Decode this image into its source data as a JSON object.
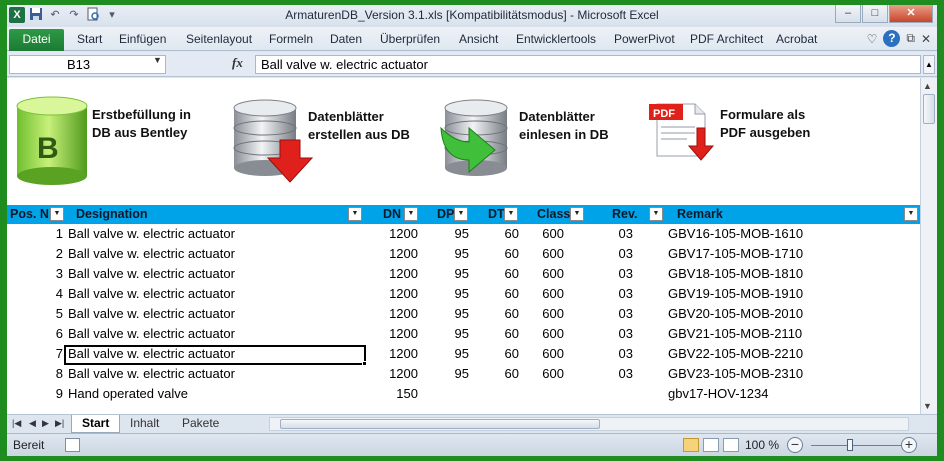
{
  "window": {
    "title": "ArmaturenDB_Version 3.1.xls  [Kompatibilitätsmodus]  -  Microsoft Excel",
    "app_icon": "X"
  },
  "ribbon": {
    "file_tab": "Datei",
    "tabs": [
      "Start",
      "Einfügen",
      "Seitenlayout",
      "Formeln",
      "Daten",
      "Überprüfen",
      "Ansicht",
      "Entwicklertools",
      "PowerPivot",
      "PDF Architect",
      "Acrobat"
    ]
  },
  "formula_bar": {
    "name_box": "B13",
    "fx": "fx",
    "value": "Ball valve w. electric actuator"
  },
  "actions": [
    {
      "label1": "Erstbefüllung in",
      "label2": "DB aus Bentley",
      "icon": "bentley-database-icon"
    },
    {
      "label1": "Datenblätter",
      "label2": "erstellen aus DB",
      "icon": "database-export-icon"
    },
    {
      "label1": "Datenblätter",
      "label2": "einlesen in DB",
      "icon": "database-import-icon"
    },
    {
      "label1": "Formulare als",
      "label2": "PDF ausgeben",
      "icon": "pdf-export-icon"
    }
  ],
  "bentley_letter": "B",
  "pdf_badge": "PDF",
  "table": {
    "headers": [
      "Pos. N",
      "Designation",
      "DN",
      "DP",
      "DT",
      "Class",
      "Rev.",
      "Remark"
    ],
    "rows": [
      {
        "pos": "1",
        "designation": "Ball valve w. electric actuator",
        "dn": "1200",
        "dp": "95",
        "dt": "60",
        "class": "600",
        "rev": "03",
        "remark": "GBV16-105-MOB-1610"
      },
      {
        "pos": "2",
        "designation": "Ball valve w. electric actuator",
        "dn": "1200",
        "dp": "95",
        "dt": "60",
        "class": "600",
        "rev": "03",
        "remark": "GBV17-105-MOB-1710"
      },
      {
        "pos": "3",
        "designation": "Ball valve w. electric actuator",
        "dn": "1200",
        "dp": "95",
        "dt": "60",
        "class": "600",
        "rev": "03",
        "remark": "GBV18-105-MOB-1810"
      },
      {
        "pos": "4",
        "designation": "Ball valve w. electric actuator",
        "dn": "1200",
        "dp": "95",
        "dt": "60",
        "class": "600",
        "rev": "03",
        "remark": "GBV19-105-MOB-1910"
      },
      {
        "pos": "5",
        "designation": "Ball valve w. electric actuator",
        "dn": "1200",
        "dp": "95",
        "dt": "60",
        "class": "600",
        "rev": "03",
        "remark": "GBV20-105-MOB-2010"
      },
      {
        "pos": "6",
        "designation": "Ball valve w. electric actuator",
        "dn": "1200",
        "dp": "95",
        "dt": "60",
        "class": "600",
        "rev": "03",
        "remark": "GBV21-105-MOB-2110"
      },
      {
        "pos": "7",
        "designation": "Ball valve w. electric actuator",
        "dn": "1200",
        "dp": "95",
        "dt": "60",
        "class": "600",
        "rev": "03",
        "remark": "GBV22-105-MOB-2210"
      },
      {
        "pos": "8",
        "designation": "Ball valve w. electric actuator",
        "dn": "1200",
        "dp": "95",
        "dt": "60",
        "class": "600",
        "rev": "03",
        "remark": "GBV23-105-MOB-2310"
      },
      {
        "pos": "9",
        "designation": "Hand operated valve",
        "dn": "150",
        "dp": "",
        "dt": "",
        "class": "",
        "rev": "",
        "remark": "gbv17-HOV-1234"
      }
    ]
  },
  "sheet_tabs": [
    "Start",
    "Inhalt",
    "Pakete"
  ],
  "status_bar": {
    "ready": "Bereit",
    "zoom": "100 %"
  },
  "colors": {
    "header_fill": "#00a2e8",
    "file_tab": "#1c7a35",
    "frame": "#1f8c1f"
  }
}
